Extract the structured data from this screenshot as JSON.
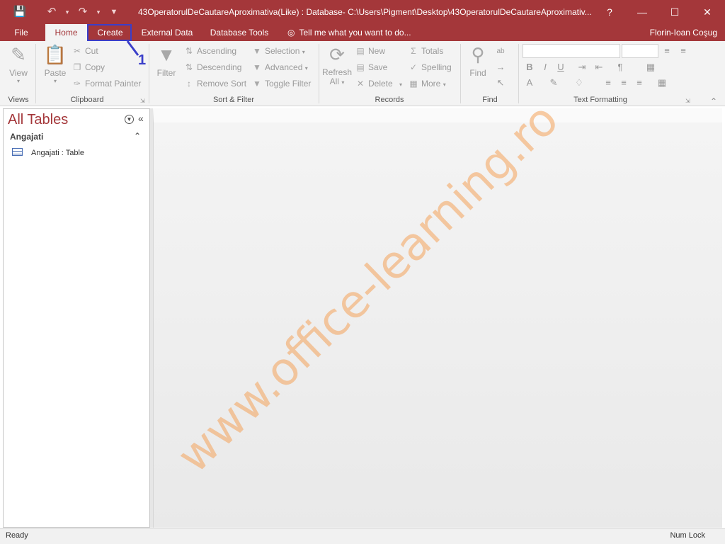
{
  "titlebar": {
    "title": "43OperatorulDeCautareAproximativa(Like) : Database- C:\\Users\\Pigment\\Desktop\\43OperatorulDeCautareAproximativ...",
    "help": "?",
    "minimize": "—",
    "maximize": "☐",
    "close": "✕",
    "save_icon": "save-icon",
    "undo_icon": "undo-icon",
    "redo_icon": "redo-icon"
  },
  "tabs": {
    "file": "File",
    "home": "Home",
    "create": "Create",
    "external_data": "External Data",
    "database_tools": "Database Tools",
    "tell_me": "Tell me what you want to do...",
    "user": "Florin-Ioan Coşug"
  },
  "callout": {
    "number": "1",
    "color": "#3a3ec9"
  },
  "ribbon": {
    "views": {
      "label": "Views",
      "view": "View"
    },
    "clipboard": {
      "label": "Clipboard",
      "paste": "Paste",
      "cut": "Cut",
      "copy": "Copy",
      "format_painter": "Format Painter"
    },
    "sort_filter": {
      "label": "Sort & Filter",
      "filter": "Filter",
      "ascending": "Ascending",
      "descending": "Descending",
      "remove_sort": "Remove Sort",
      "selection": "Selection",
      "advanced": "Advanced",
      "toggle_filter": "Toggle Filter"
    },
    "records": {
      "label": "Records",
      "refresh": "Refresh",
      "refresh_all": "All",
      "new": "New",
      "save": "Save",
      "delete": "Delete",
      "totals": "Totals",
      "spelling": "Spelling",
      "more": "More"
    },
    "find": {
      "label": "Find",
      "find": "Find"
    },
    "text_formatting": {
      "label": "Text Formatting"
    }
  },
  "navpane": {
    "title": "All Tables",
    "group": "Angajati",
    "item": "Angajati : Table"
  },
  "watermark": "www.office-learning.ro",
  "status": {
    "left": "Ready",
    "right": "Num Lock"
  },
  "colors": {
    "accent": "#a4373a",
    "ribbon_bg": "#f3f3f3"
  }
}
